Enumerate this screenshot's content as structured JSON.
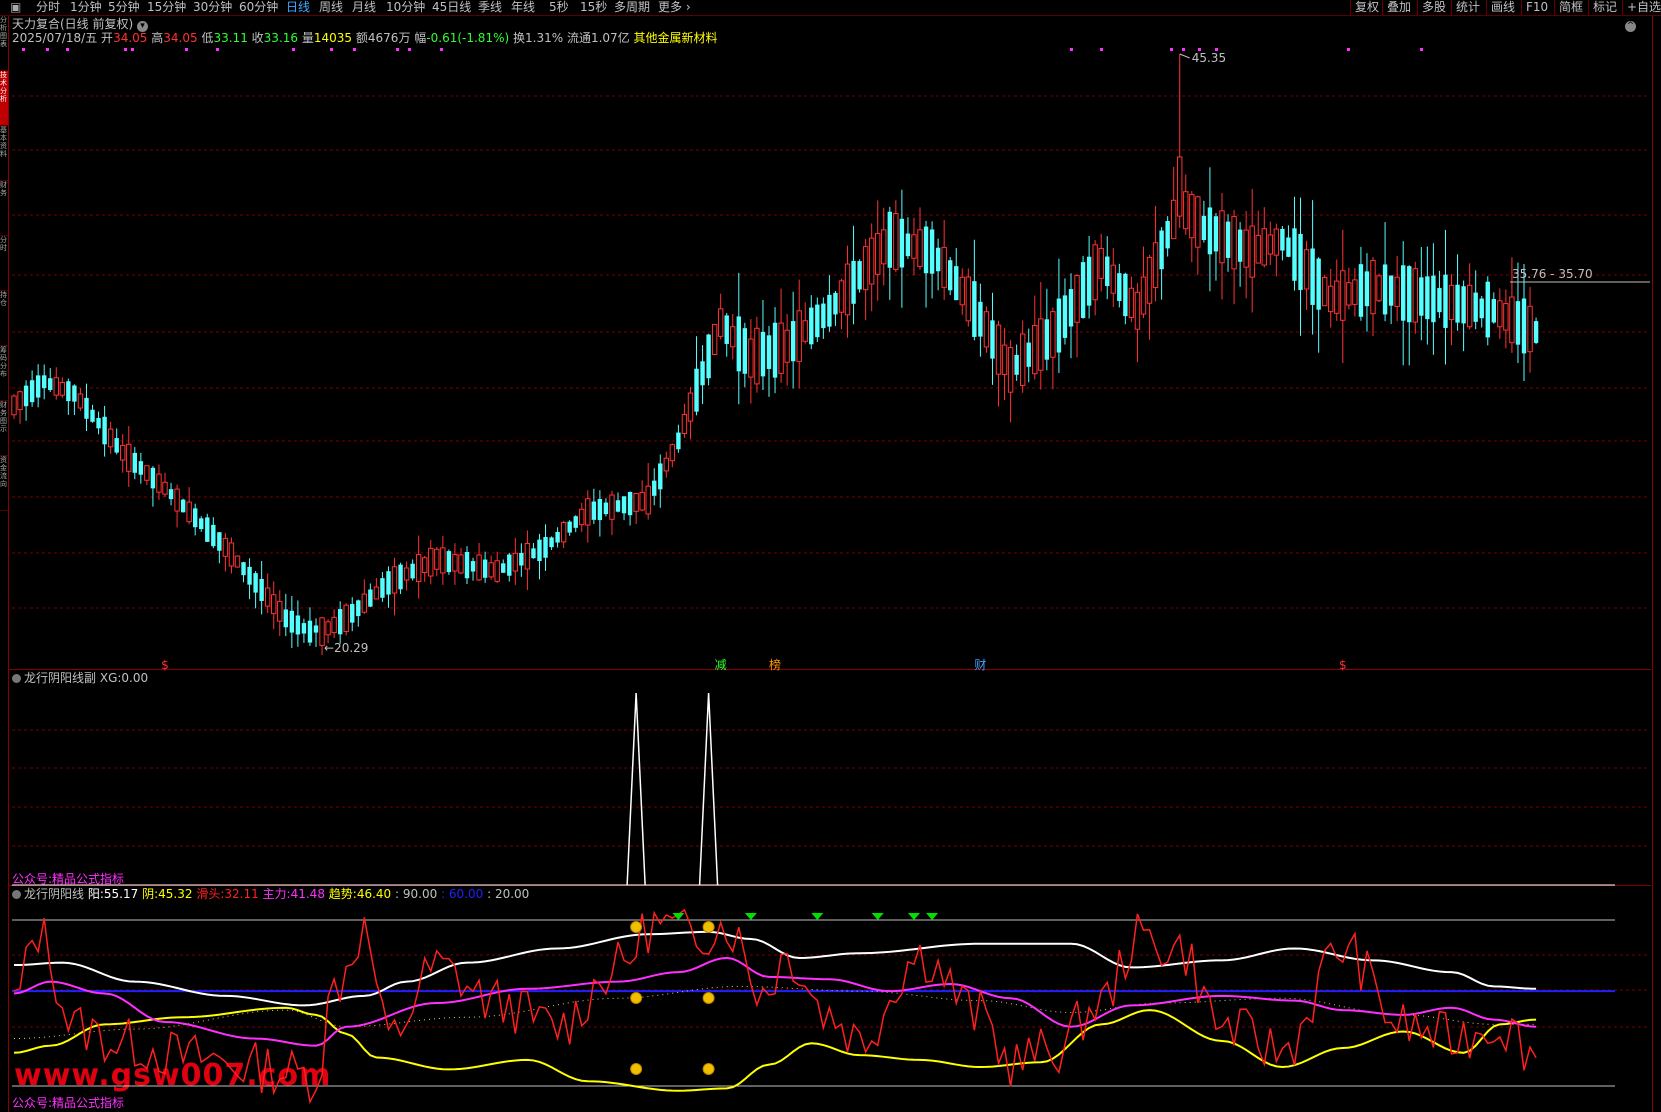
{
  "toolbar": {
    "periods": [
      "分时",
      "1分钟",
      "5分钟",
      "15分钟",
      "30分钟",
      "60分钟",
      "日线",
      "周线",
      "月线",
      "10分钟",
      "45日线",
      "季线",
      "年线",
      "5秒",
      "15秒",
      "多周期",
      "更多"
    ],
    "active_period": "日线",
    "right_buttons": [
      "复权",
      "叠加",
      "多股",
      "统计",
      "画线",
      "F10",
      "简框",
      "标记",
      "+自选"
    ]
  },
  "main": {
    "title": "天力复合(日线 前复权)",
    "date": "2025/07/18/五",
    "open_label": "开",
    "open": "34.05",
    "high_label": "高",
    "high": "34.05",
    "low_label": "低",
    "low": "33.11",
    "close_label": "收",
    "close": "33.16",
    "vol_label": "量",
    "vol": "14035",
    "amt_label": "额",
    "amt": "4676万",
    "chg_label": "幅",
    "chg": "-0.61(-1.81%)",
    "turnover": "换1.31%",
    "float": "流通1.07亿",
    "concept": "其他金属新材料",
    "max_label": "45.35",
    "min_label": "20.29",
    "range_label": "35.76 - 35.70",
    "markers": [
      {
        "text": "$",
        "color": "#ff3030",
        "index": 25
      },
      {
        "text": "减",
        "color": "#30ff30",
        "index": 117
      },
      {
        "text": "榜",
        "color": "#ff9900",
        "index": 126
      },
      {
        "text": "财",
        "color": "#40a0ff",
        "index": 160
      },
      {
        "text": "$",
        "color": "#ff3030",
        "index": 220
      }
    ]
  },
  "sub1": {
    "name": "龙行阴阳线副",
    "xg_label": "XG:",
    "xg_value": "0.00",
    "footer": "公众号:精品公式指标",
    "spikes": [
      103,
      115
    ]
  },
  "sub2": {
    "name": "龙行阴阳线",
    "yang_label": "阳:",
    "yang": "55.17",
    "yin_label": "阴:",
    "yin": "45.32",
    "hua_label": "滑头:",
    "hua": "32.11",
    "zhu_label": "主力:",
    "zhu": "41.48",
    "qs_label": "趋势:",
    "qs": "46.40",
    "l90": ": 90.00",
    "l60": ": 60.00",
    "l20": ": 20.00",
    "footer": "公众号:精品公式指标",
    "watermark": "www.gsw007.com",
    "colors": {
      "yang": "#ffffff",
      "yin": "#ffff00",
      "hua": "#ff2020",
      "zhu": "#ff30ff",
      "qs": "#ffff00",
      "l60": "#2020ff"
    }
  },
  "left_tabs": [
    "分析图表",
    "技术分析",
    "基本资料",
    "财务",
    "分时",
    "持仓",
    "筹码分布",
    "财务图示",
    "资金流向"
  ],
  "colors": {
    "up": "#ff3232",
    "down": "#54ffff",
    "grid": "#8a0000",
    "text": "#c0c0c0"
  }
}
